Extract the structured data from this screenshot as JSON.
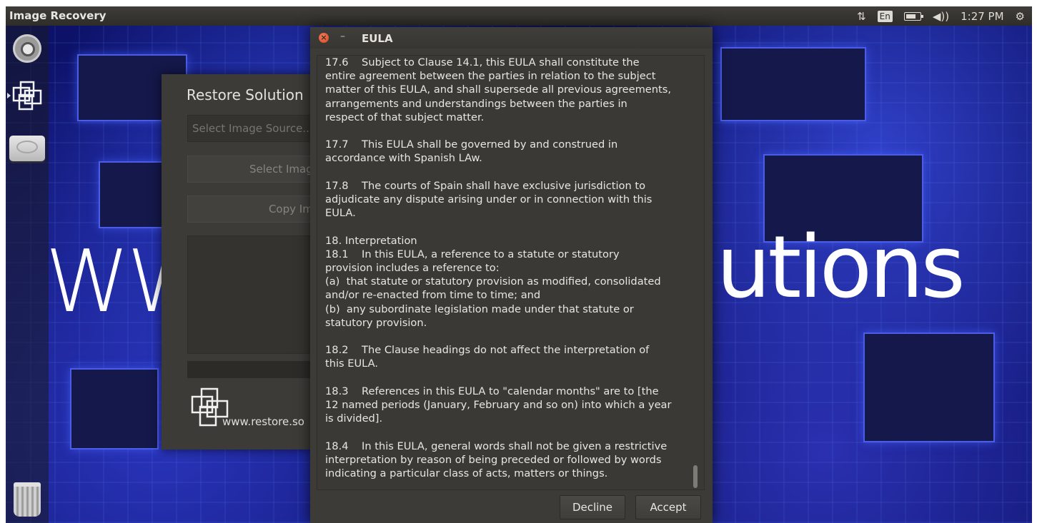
{
  "topbar": {
    "app_title": "Image Recovery",
    "keyboard_layout": "En",
    "clock": "1:27 PM"
  },
  "desktop": {
    "wallpaper_text_left": "WW",
    "wallpaper_text_right": "lutions"
  },
  "launcher": {
    "items": [
      "ubuntu-dash",
      "restore-solutions",
      "disk-drive",
      "trash"
    ]
  },
  "restore_window": {
    "title": "Restore Solution",
    "image_source_placeholder": "Select Image Source...",
    "select_image_label": "Select Image",
    "copy_image_label": "Copy Ima",
    "website": "www.restore.so"
  },
  "eula": {
    "title": "EULA",
    "minimize": "–",
    "body": "17.6    Subject to Clause 14.1, this EULA shall constitute the\nentire agreement between the parties in relation to the subject\nmatter of this EULA, and shall supersede all previous agreements,\narrangements and understandings between the parties in\nrespect of that subject matter.\n\n17.7    This EULA shall be governed by and construed in\naccordance with Spanish LAw.\n\n17.8    The courts of Spain shall have exclusive jurisdiction to\nadjudicate any dispute arising under or in connection with this\nEULA.\n\n18. Interpretation\n18.1    In this EULA, a reference to a statute or statutory\nprovision includes a reference to:\n(a)  that statute or statutory provision as modified, consolidated\nand/or re-enacted from time to time; and\n(b)  any subordinate legislation made under that statute or\nstatutory provision.\n\n18.2    The Clause headings do not affect the interpretation of\nthis EULA.\n\n18.3    References in this EULA to \"calendar months\" are to [the\n12 named periods (January, February and so on) into which a year\nis divided].\n\n18.4    In this EULA, general words shall not be given a restrictive\ninterpretation by reason of being preceded or followed by words\nindicating a particular class of acts, matters or things.",
    "decline_label": "Decline",
    "accept_label": "Accept"
  },
  "colors": {
    "panel": "#3c3b37",
    "close_button": "#df4b1f",
    "wallpaper": "#0d1268"
  }
}
